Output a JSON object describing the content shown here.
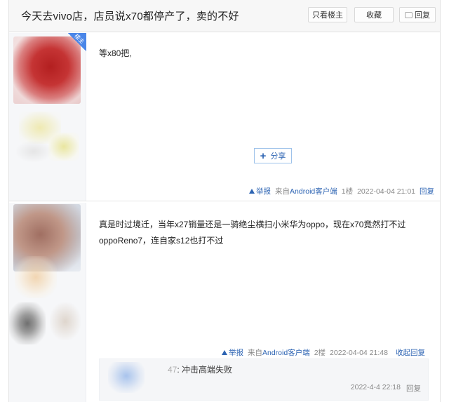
{
  "thread": {
    "title": "今天去vivo店，店员说x70都停产了，卖的不好",
    "buttons": {
      "only_op": "只看楼主",
      "favorite": "收藏",
      "reply": "回复"
    }
  },
  "posts": [
    {
      "badge": "楼主",
      "content": "等x80把,",
      "share_label": "分享",
      "tail": {
        "report": "举报",
        "from_prefix": "来自",
        "from_client": "Android客户端",
        "floor": "1楼",
        "time": "2022-04-04 21:01",
        "reply": "回复"
      }
    },
    {
      "content": "真是时过境迁，当年x27销量还是一骑绝尘横扫小米华为oppo，现在x70竟然打不过oppoReno7，连自家s12也打不过",
      "tail": {
        "report": "举报",
        "from_prefix": "来自",
        "from_client": "Android客户端",
        "floor": "2楼",
        "time": "2022-04-04 21:48",
        "collapse": "收起回复"
      },
      "sub_reply": {
        "username": "47",
        "text": ": 冲击高端失败",
        "time": "2022-4-4 22:18",
        "reply": "回复"
      }
    }
  ]
}
